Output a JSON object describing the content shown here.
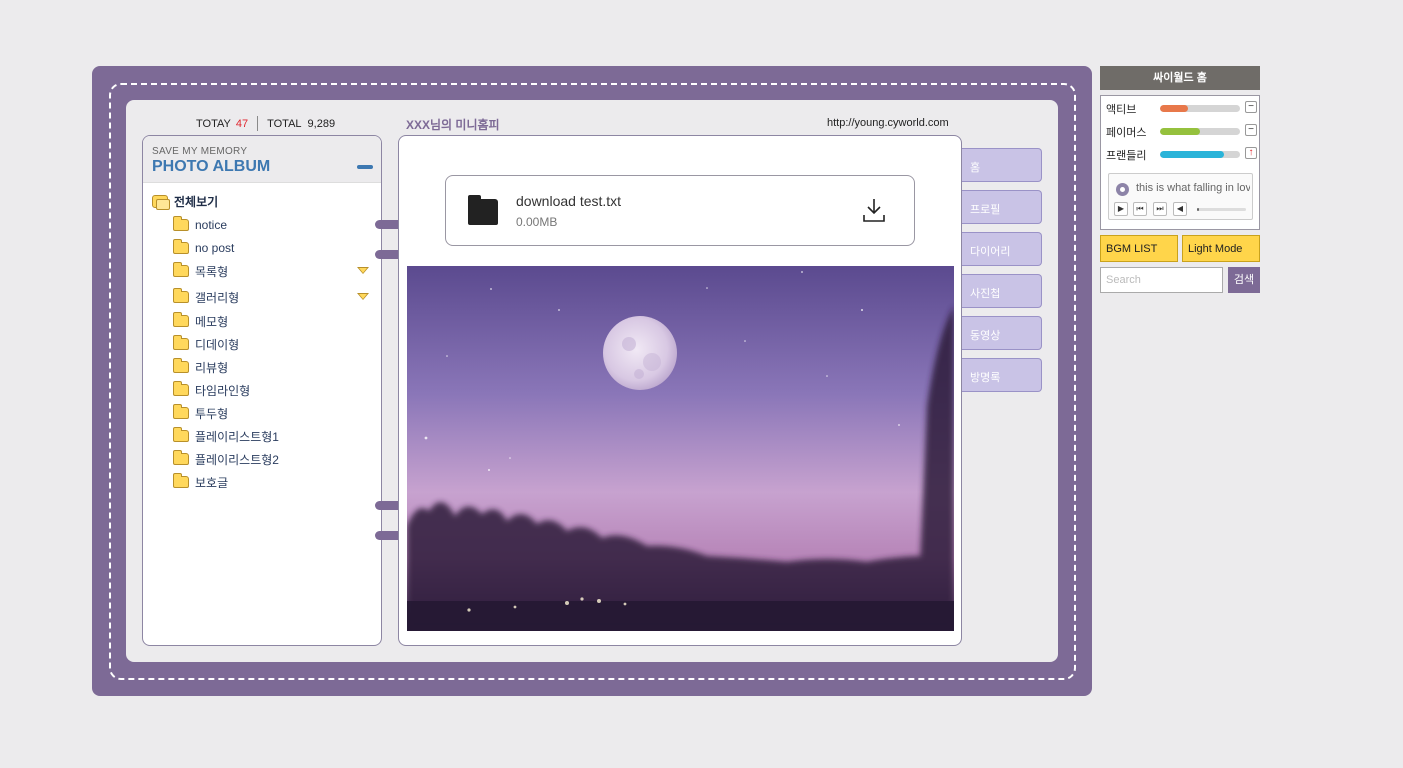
{
  "header": {
    "today_label": "TOTAY",
    "today_count": "47",
    "total_label": "TOTAL",
    "total_count": "9,289",
    "title": "XXX님의 미니홈피",
    "url": "http://young.cyworld.com"
  },
  "sidebar": {
    "subtitle": "SAVE MY MEMORY",
    "title": "PHOTO ALBUM",
    "folders": [
      {
        "label": "전체보기",
        "root": true
      },
      {
        "label": "notice"
      },
      {
        "label": "no post"
      },
      {
        "label": "목록형",
        "expandable": true
      },
      {
        "label": "갤러리형",
        "expandable": true
      },
      {
        "label": "메모형"
      },
      {
        "label": "디데이형"
      },
      {
        "label": "리뷰형"
      },
      {
        "label": "타임라인형"
      },
      {
        "label": "투두형"
      },
      {
        "label": "플레이리스트형1"
      },
      {
        "label": "플레이리스트형2"
      },
      {
        "label": "보호글"
      }
    ]
  },
  "download": {
    "filename": "download test.txt",
    "size": "0.00MB",
    "icon": "folder-icon",
    "action_icon": "download-icon"
  },
  "menu": [
    "홈",
    "프로필",
    "다이어리",
    "사진첩",
    "동영상",
    "방명록"
  ],
  "right": {
    "home_label": "싸이월드 홈",
    "stats": [
      {
        "label": "액티브",
        "level": 0.35,
        "color": "#e8784a",
        "button": "−"
      },
      {
        "label": "페이머스",
        "level": 0.5,
        "color": "#95c13d",
        "button": "−"
      },
      {
        "label": "프랜들리",
        "level": 0.8,
        "color": "#2ab4d9",
        "button": "↑"
      }
    ],
    "player": {
      "song": "this is what falling in love feels like",
      "volume": 0.05
    },
    "bgm_label": "BGM LIST",
    "light_label": "Light Mode",
    "search_placeholder": "Search",
    "search_button": "검색"
  }
}
